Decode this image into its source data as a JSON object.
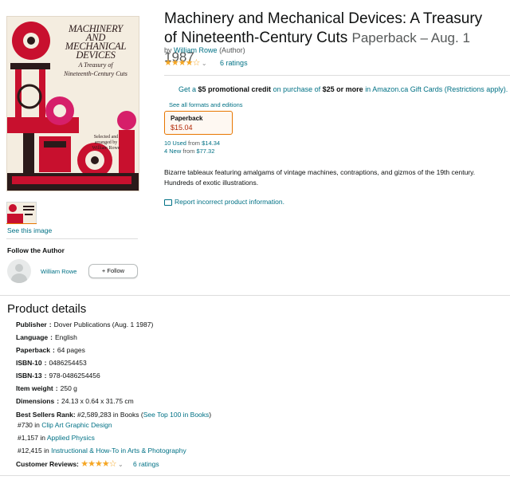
{
  "product": {
    "title": "Machinery and Mechanical Devices: A Treasury of Nineteenth-Century Cuts",
    "format_date": "Paperback – Aug. 1 1987",
    "byline_prefix": "by",
    "author": "William Rowe",
    "author_role": "(Author)",
    "ratings_count": "6 ratings"
  },
  "cover": {
    "title_lines": [
      "MACHINERY",
      "AND",
      "MECHANICAL",
      "DEVICES"
    ],
    "subtitle_lines": [
      "A Treasury of",
      "Nineteenth-Century Cuts"
    ],
    "credit_lines": [
      "Selected and",
      "arranged by",
      "William Rowe"
    ]
  },
  "promo": {
    "prefix": "Get a",
    "amount": "$5 promotional credit",
    "middle": "on purchase of",
    "threshold": "$25 or more",
    "suffix": "in Amazon.ca Gift Cards (Restrictions apply)."
  },
  "formats": {
    "see_all": "See all formats and editions",
    "selected_label": "Paperback",
    "selected_price": "$15.04",
    "used_count": "10 Used",
    "used_from_word": "from",
    "used_price": "$14.34",
    "new_count": "4 New",
    "new_from_word": "from",
    "new_price": "$77.32"
  },
  "description": "Bizarre tableaux featuring amalgams of vintage machines, contraptions, and gizmos of the 19th century. Hundreds of exotic illustrations.",
  "report_link": "Report incorrect product information.",
  "see_image": "See this image",
  "follow": {
    "heading": "Follow the Author",
    "author": "William Rowe",
    "button": "+ Follow"
  },
  "details": {
    "heading": "Product details",
    "rows": [
      {
        "key": "Publisher",
        "value": "Dover Publications (Aug. 1 1987)"
      },
      {
        "key": "Language",
        "value": "English"
      },
      {
        "key": "Paperback",
        "value": "64 pages"
      },
      {
        "key": "ISBN-10",
        "value": "0486254453"
      },
      {
        "key": "ISBN-13",
        "value": "978-0486254456"
      },
      {
        "key": "Item weight",
        "value": "250 g"
      },
      {
        "key": "Dimensions",
        "value": "24.13 x 0.64 x 31.75 cm"
      }
    ],
    "rank_key": "Best Sellers Rank:",
    "rank_value": "#2,589,283 in Books (",
    "rank_link": "See Top 100 in Books",
    "rank_close": ")",
    "sub_ranks": [
      {
        "rank": "#730 in",
        "category": "Clip Art Graphic Design"
      },
      {
        "rank": "#1,157 in",
        "category": "Applied Physics"
      },
      {
        "rank": "#12,415 in",
        "category": "Instructional & How-To in Arts & Photography"
      }
    ],
    "reviews_key": "Customer Reviews:",
    "reviews_count": "6 ratings"
  },
  "rating": {
    "stars": 4,
    "out_of": 5
  },
  "colors": {
    "link": "#007185",
    "price": "#b12704",
    "star": "#f5a623",
    "selected_border": "#e77600",
    "cover_red": "#c8102e"
  },
  "icons": [
    "star-icon",
    "chevron-down-icon",
    "report-icon",
    "avatar-placeholder-icon"
  ]
}
